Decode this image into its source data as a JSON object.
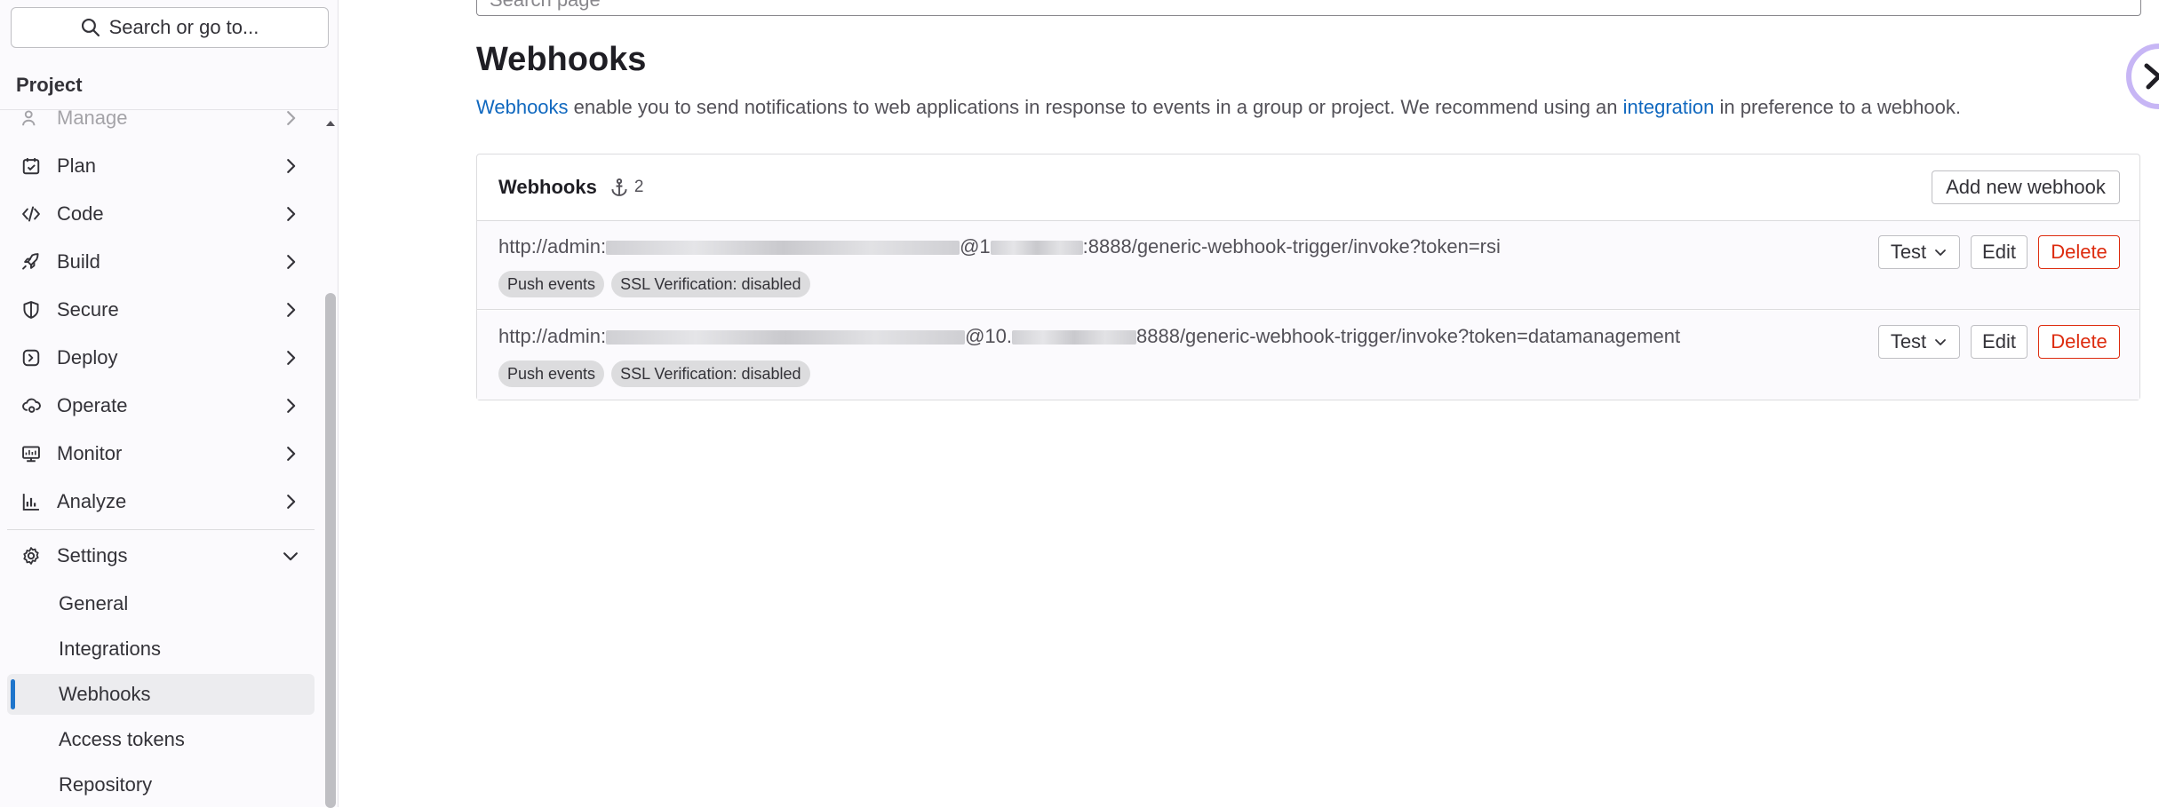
{
  "sidebar": {
    "search_label": "Search or go to...",
    "project_label": "Project",
    "items": {
      "manage": "Manage",
      "plan": "Plan",
      "code": "Code",
      "build": "Build",
      "secure": "Secure",
      "deploy": "Deploy",
      "operate": "Operate",
      "monitor": "Monitor",
      "analyze": "Analyze",
      "settings": "Settings"
    },
    "settings_sub": {
      "general": "General",
      "integrations": "Integrations",
      "webhooks": "Webhooks",
      "access_tokens": "Access tokens",
      "repository": "Repository"
    }
  },
  "main": {
    "top_search_placeholder": "Search page",
    "title": "Webhooks",
    "description": {
      "link1": "Webhooks",
      "text1": " enable you to send notifications to web applications in response to events in a group or project. We recommend using an ",
      "link2": "integration",
      "text2": " in preference to a webhook."
    },
    "card": {
      "title": "Webhooks",
      "count": "2",
      "add_button": "Add new webhook",
      "hooks": [
        {
          "url_prefix": "http://admin:",
          "url_mid": "@1",
          "url_suffix": ":8888/generic-webhook-trigger/invoke?token=rsi",
          "badges": [
            "Push events",
            "SSL Verification: disabled"
          ],
          "test": "Test",
          "edit": "Edit",
          "delete": "Delete"
        },
        {
          "url_prefix": "http://admin:",
          "url_mid": "@10.",
          "url_suffix": "8888/generic-webhook-trigger/invoke?token=datamanagement",
          "badges": [
            "Push events",
            "SSL Verification: disabled"
          ],
          "test": "Test",
          "edit": "Edit",
          "delete": "Delete"
        }
      ]
    }
  },
  "colors": {
    "link": "#1068bf",
    "danger": "#dd2b0e",
    "active_indicator": "#1f75cb"
  }
}
